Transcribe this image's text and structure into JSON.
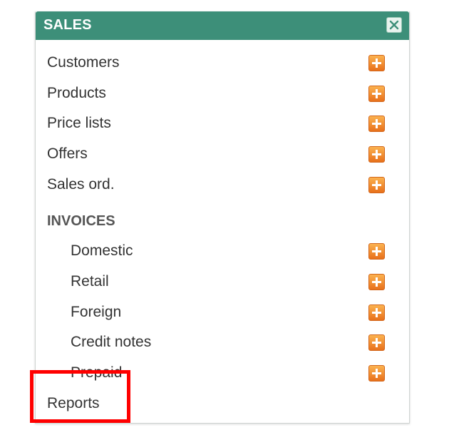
{
  "header": {
    "title": "SALES",
    "close_icon": "close-icon"
  },
  "menu": {
    "items": [
      {
        "label": "Customers",
        "icon": "add-icon"
      },
      {
        "label": "Products",
        "icon": "add-icon"
      },
      {
        "label": "Price lists",
        "icon": "add-icon"
      },
      {
        "label": "Offers",
        "icon": "add-icon"
      },
      {
        "label": "Sales ord.",
        "icon": "add-icon"
      }
    ],
    "section": {
      "title": "INVOICES",
      "items": [
        {
          "label": "Domestic",
          "icon": "add-icon"
        },
        {
          "label": "Retail",
          "icon": "add-icon"
        },
        {
          "label": "Foreign",
          "icon": "add-icon"
        },
        {
          "label": "Credit notes",
          "icon": "add-icon"
        },
        {
          "label": "Prepaid",
          "icon": "add-icon"
        }
      ]
    },
    "reports": {
      "label": "Reports"
    }
  },
  "colors": {
    "header_bg": "#3d8f79",
    "add_icon": "#f08a2b",
    "highlight": "#ff0000"
  }
}
